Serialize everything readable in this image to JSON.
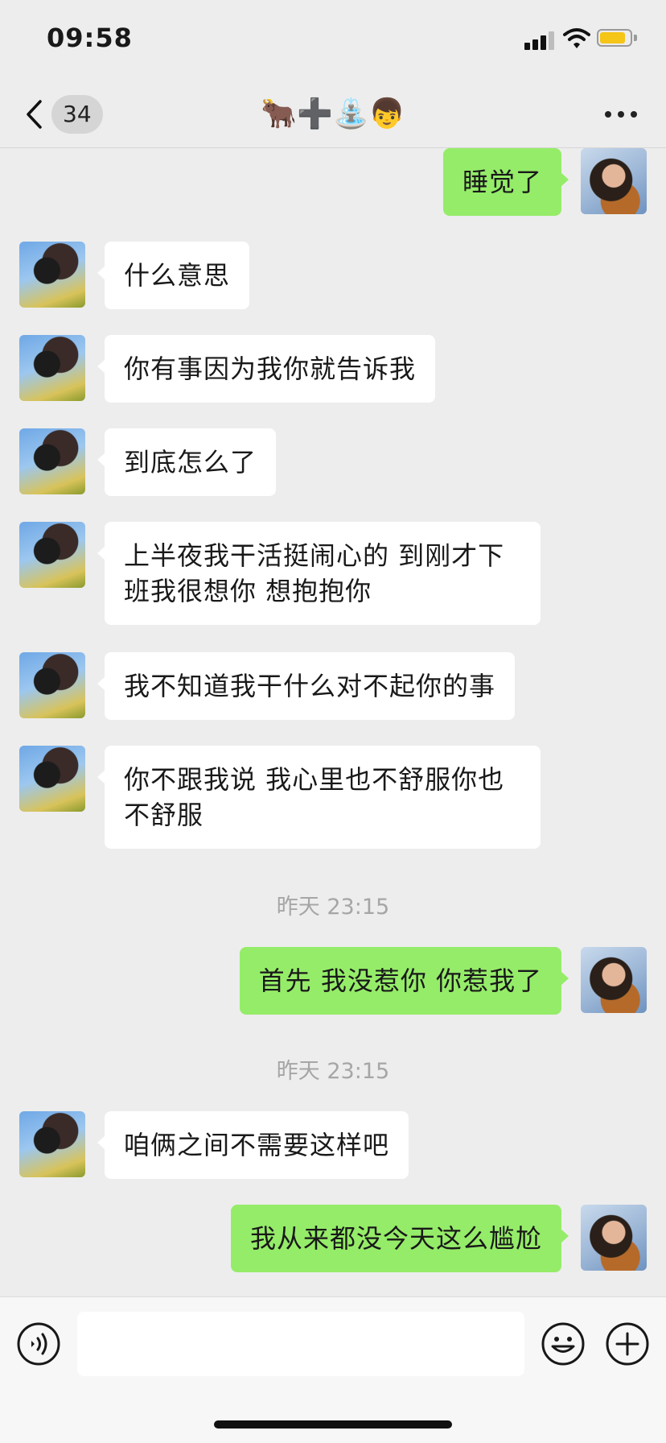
{
  "status_bar": {
    "time": "09:58",
    "battery_color": "#f5c518"
  },
  "nav": {
    "unread_count": "34",
    "title": "🐂➕⛲👦",
    "more_label": "more"
  },
  "colors": {
    "sent_bubble": "#95ec69",
    "received_bubble": "#ffffff",
    "background": "#ededed"
  },
  "messages": [
    {
      "side": "right",
      "text": "睡觉了"
    },
    {
      "side": "left",
      "text": "什么意思"
    },
    {
      "side": "left",
      "text": "你有事因为我你就告诉我"
    },
    {
      "side": "left",
      "text": "到底怎么了"
    },
    {
      "side": "left",
      "text": "上半夜我干活挺闹心的 到刚才下班我很想你 想抱抱你"
    },
    {
      "side": "left",
      "text": "我不知道我干什么对不起你的事"
    },
    {
      "side": "left",
      "text": "你不跟我说 我心里也不舒服你也不舒服"
    },
    {
      "side": "time",
      "text": "昨天 23:15"
    },
    {
      "side": "right",
      "text": "首先 我没惹你 你惹我了"
    },
    {
      "side": "time",
      "text": "昨天 23:15"
    },
    {
      "side": "left",
      "text": "咱俩之间不需要这样吧"
    },
    {
      "side": "right",
      "text": "我从来都没今天这么尴尬"
    }
  ],
  "input": {
    "value": "",
    "placeholder": ""
  },
  "icons": {
    "back": "chevron-left-icon",
    "more": "more-dots-icon",
    "voice": "voice-icon",
    "emoji": "emoji-icon",
    "plus": "plus-icon"
  }
}
